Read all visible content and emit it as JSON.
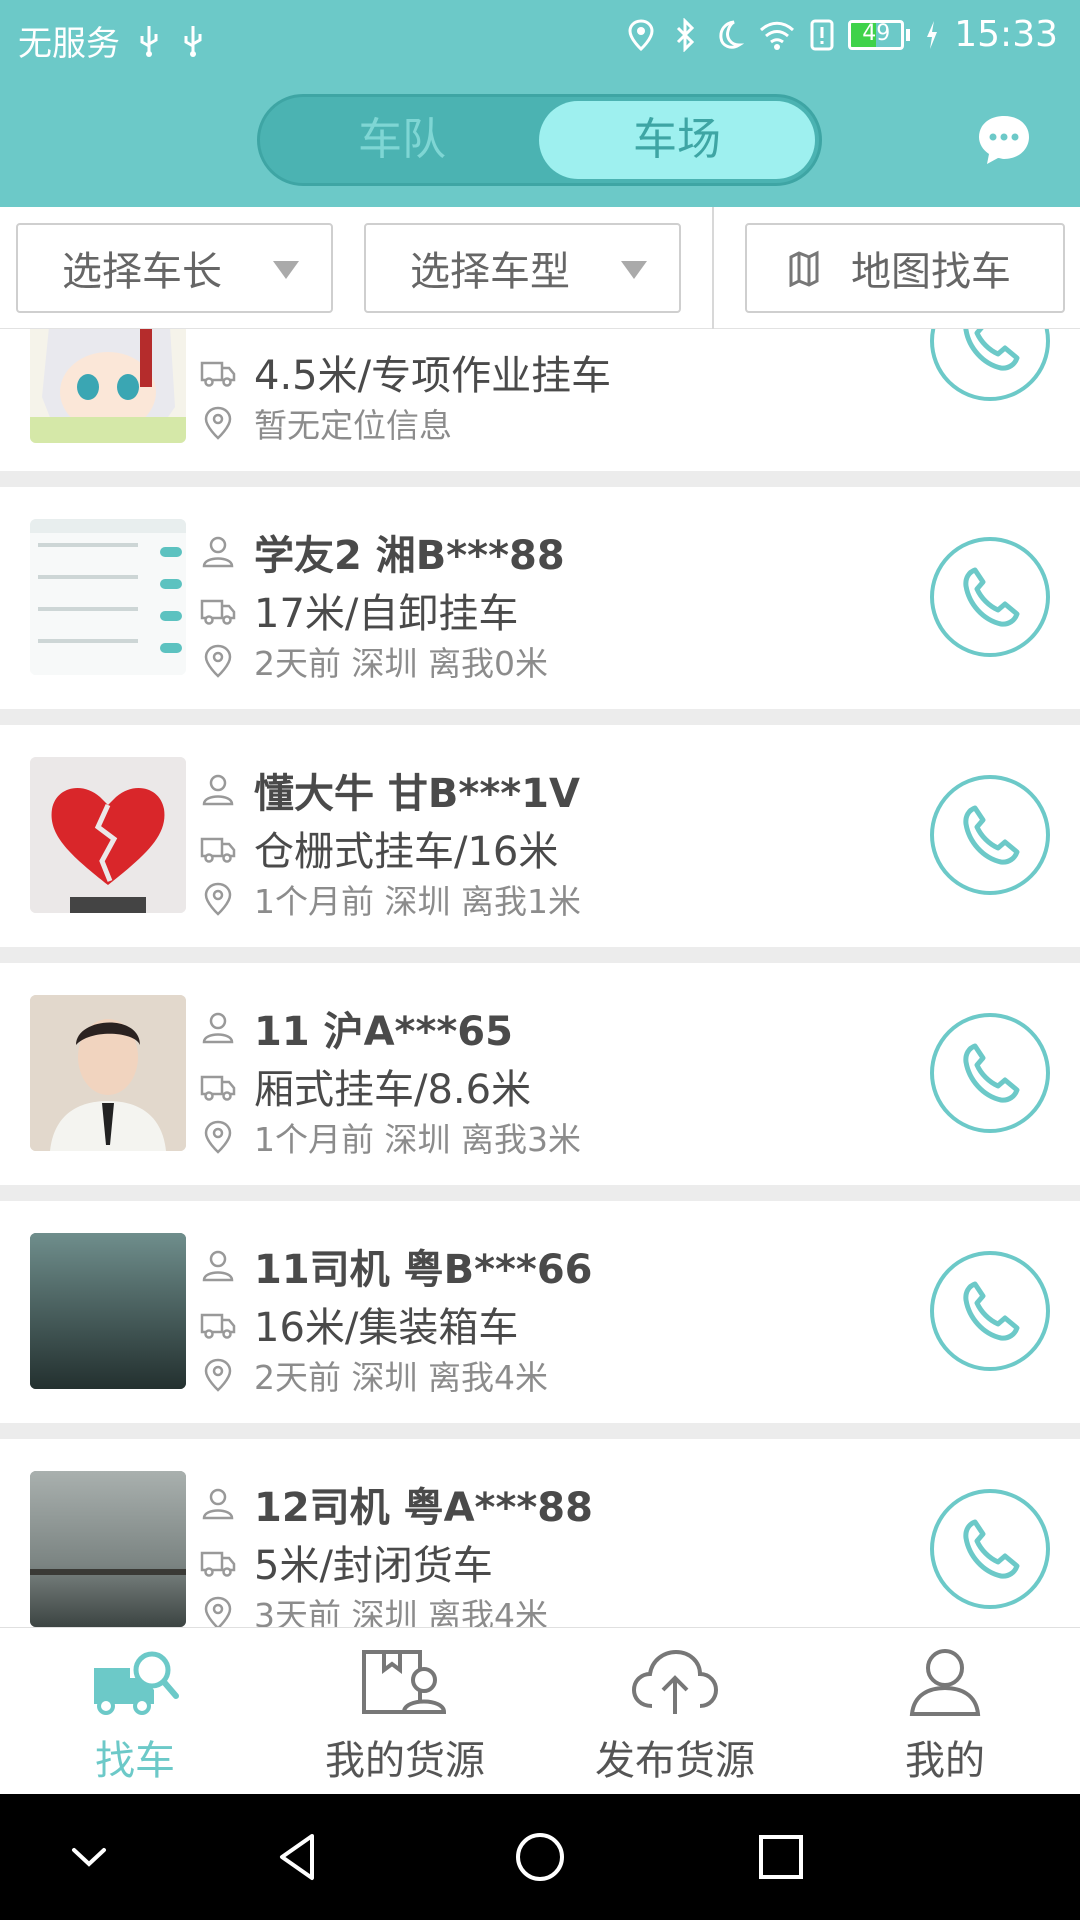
{
  "status_bar": {
    "carrier": "无服务",
    "battery_percent": "49",
    "battery_level": 0.49,
    "time": "15:33"
  },
  "header": {
    "segments": [
      {
        "label": "车队",
        "active": false
      },
      {
        "label": "车场",
        "active": true
      }
    ],
    "message_icon": "chat-bubble-icon"
  },
  "filters": {
    "length_label": "选择车长",
    "type_label": "选择车型",
    "map_label": "地图找车"
  },
  "vehicles": [
    {
      "name": "",
      "spec": "4.5米/专项作业挂车",
      "location": "暂无定位信息",
      "avatar": "anime"
    },
    {
      "name": "学友2 湘B***88",
      "spec": "17米/自卸挂车",
      "location": "2天前 深圳 离我0米",
      "avatar": "screenshot"
    },
    {
      "name": "懂大牛 甘B***1V",
      "spec": "仓栅式挂车/16米",
      "location": "1个月前 深圳 离我1米",
      "avatar": "heart"
    },
    {
      "name": "11 沪A***65",
      "spec": "厢式挂车/8.6米",
      "location": "1个月前 深圳 离我3米",
      "avatar": "portrait"
    },
    {
      "name": "11司机 粤B***66",
      "spec": "16米/集装箱车",
      "location": "2天前 深圳 离我4米",
      "avatar": "dark"
    },
    {
      "name": "12司机 粤A***88",
      "spec": "5米/封闭货车",
      "location": "3天前 深圳 离我4米",
      "avatar": "gray"
    }
  ],
  "bottom_nav": [
    {
      "label": "找车",
      "icon": "truck-search-icon",
      "active": true
    },
    {
      "label": "我的货源",
      "icon": "box-person-icon",
      "active": false
    },
    {
      "label": "发布货源",
      "icon": "cloud-upload-icon",
      "active": false
    },
    {
      "label": "我的",
      "icon": "user-icon",
      "active": false
    }
  ],
  "colors": {
    "brand": "#6cc9c8",
    "active_segment": "#9ef0ef"
  }
}
